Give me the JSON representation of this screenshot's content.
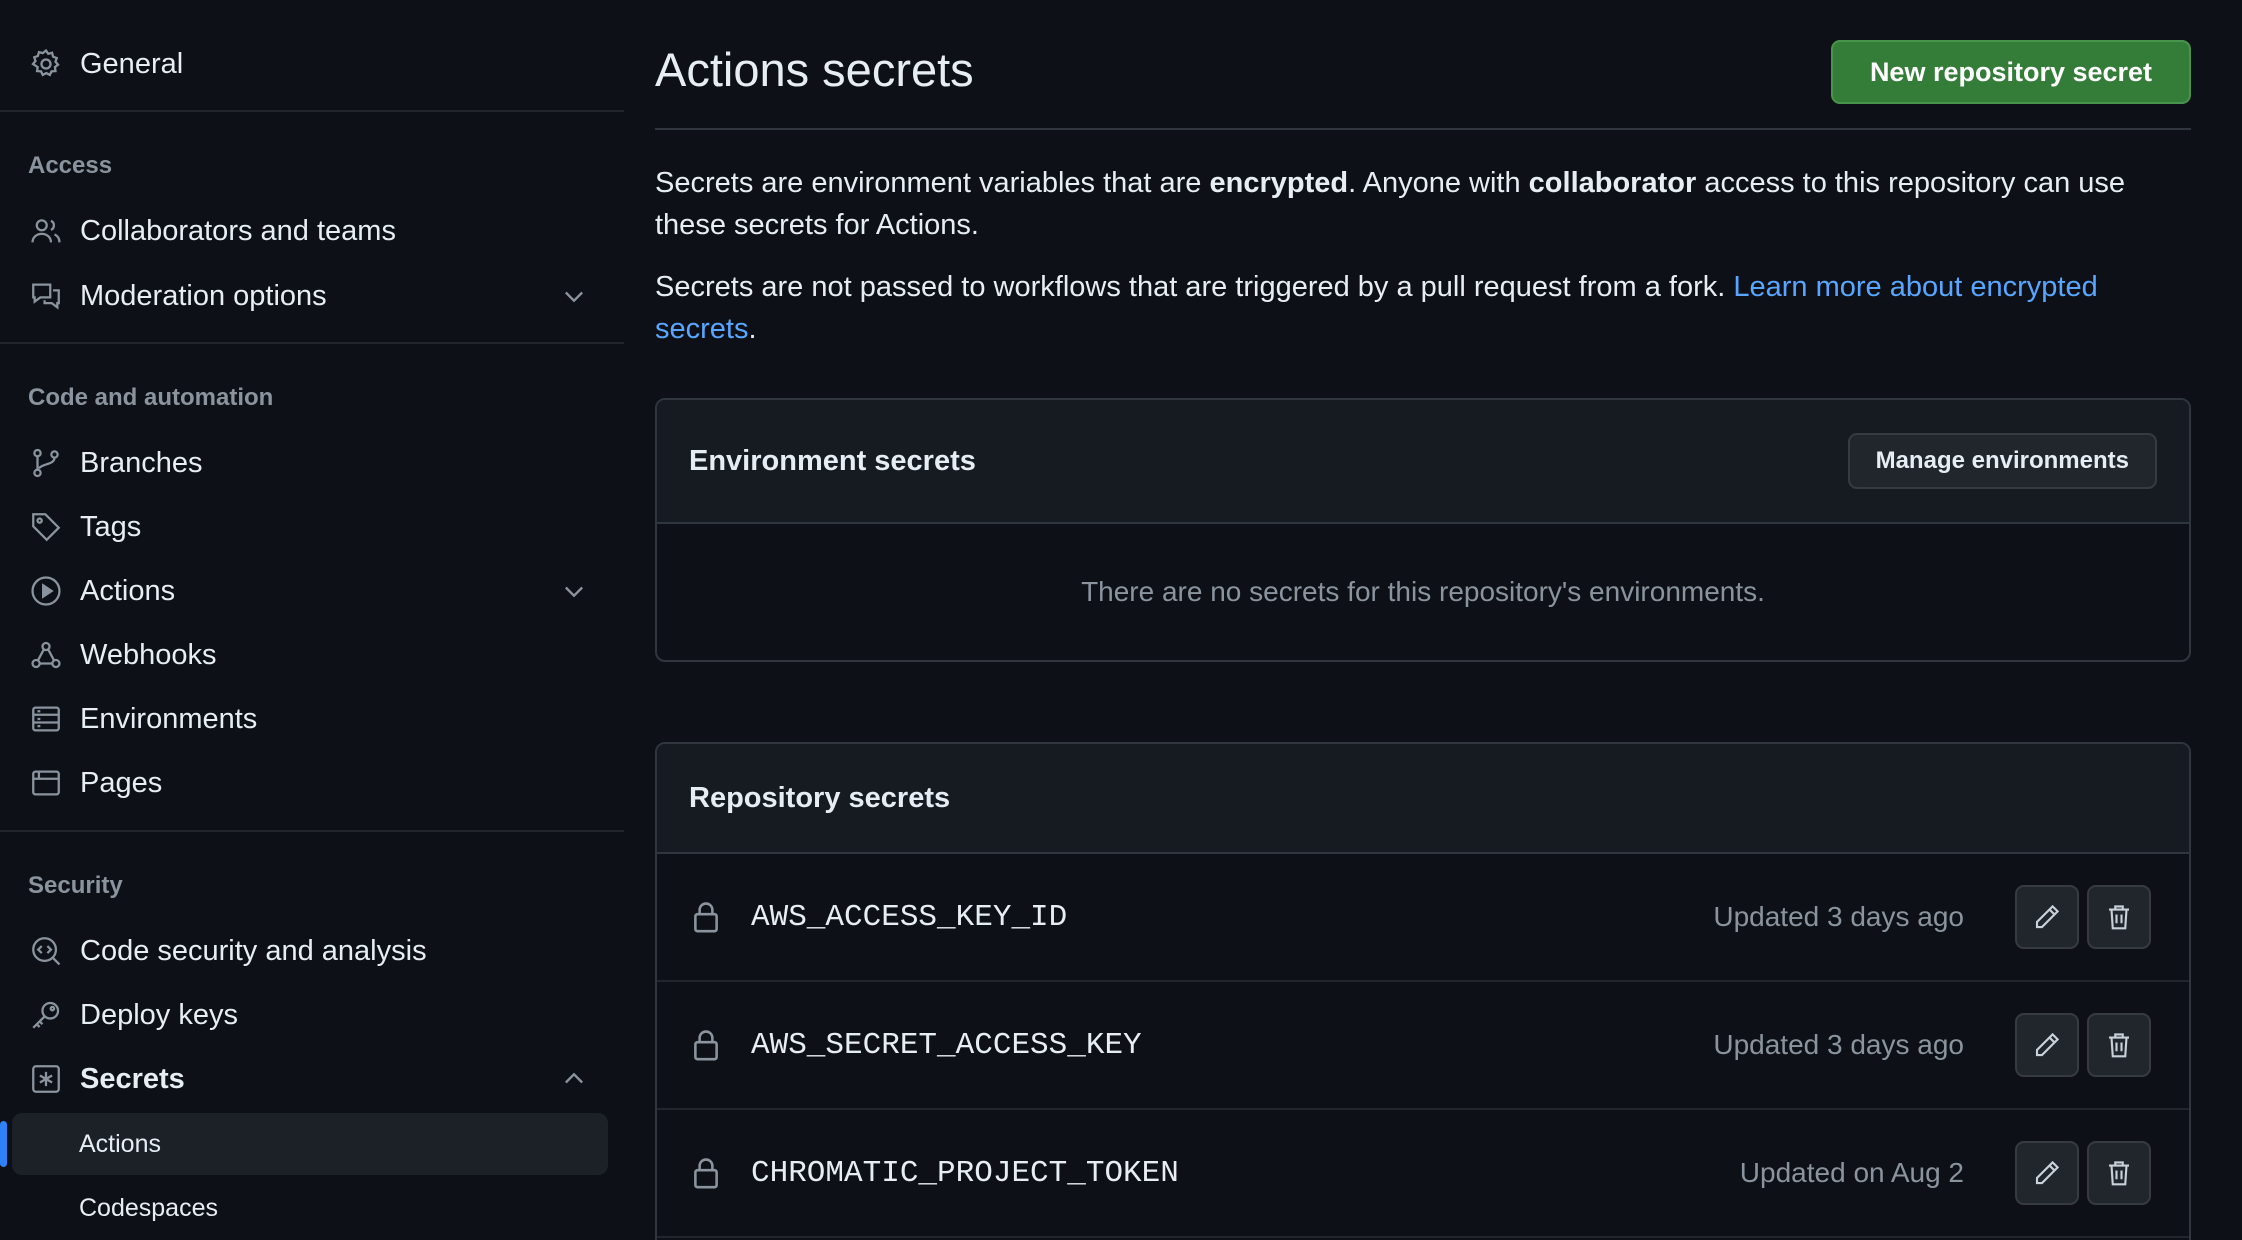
{
  "sidebar": {
    "general": "General",
    "access_label": "Access",
    "access_items": [
      {
        "label": "Collaborators and teams",
        "icon": "people-icon"
      },
      {
        "label": "Moderation options",
        "icon": "comment-discussion-icon"
      }
    ],
    "code_label": "Code and automation",
    "code_items": [
      {
        "label": "Branches",
        "icon": "git-branch-icon"
      },
      {
        "label": "Tags",
        "icon": "tag-icon"
      },
      {
        "label": "Actions",
        "icon": "play-icon"
      },
      {
        "label": "Webhooks",
        "icon": "webhook-icon"
      },
      {
        "label": "Environments",
        "icon": "server-icon"
      },
      {
        "label": "Pages",
        "icon": "browser-icon"
      }
    ],
    "security_label": "Security",
    "security_items": [
      {
        "label": "Code security and analysis",
        "icon": "codescan-icon"
      },
      {
        "label": "Deploy keys",
        "icon": "key-icon"
      },
      {
        "label": "Secrets",
        "icon": "asterisk-icon"
      }
    ],
    "secrets_sub": [
      {
        "label": "Actions",
        "active": true
      },
      {
        "label": "Codespaces",
        "active": false
      }
    ]
  },
  "main": {
    "title": "Actions secrets",
    "new_button": "New repository secret",
    "intro": {
      "t1": "Secrets are environment variables that are ",
      "b1": "encrypted",
      "t2": ". Anyone with ",
      "b2": "collaborator",
      "t3": " access to this repository can use these secrets for Actions."
    },
    "fork_note": {
      "text": "Secrets are not passed to workflows that are triggered by a pull request from a fork. ",
      "link": "Learn more about encrypted secrets",
      "end": "."
    },
    "environment": {
      "title": "Environment secrets",
      "manage_button": "Manage environments",
      "empty": "There are no secrets for this repository's environments."
    },
    "repository": {
      "title": "Repository secrets",
      "secrets": [
        {
          "name": "AWS_ACCESS_KEY_ID",
          "updated": "Updated 3 days ago"
        },
        {
          "name": "AWS_SECRET_ACCESS_KEY",
          "updated": "Updated 3 days ago"
        },
        {
          "name": "CHROMATIC_PROJECT_TOKEN",
          "updated": "Updated on Aug 2"
        }
      ]
    }
  },
  "colors": {
    "background": "#0d1117",
    "primary_button": "#347d39",
    "link": "#58a6ff",
    "active_indicator": "#2f81f7"
  }
}
